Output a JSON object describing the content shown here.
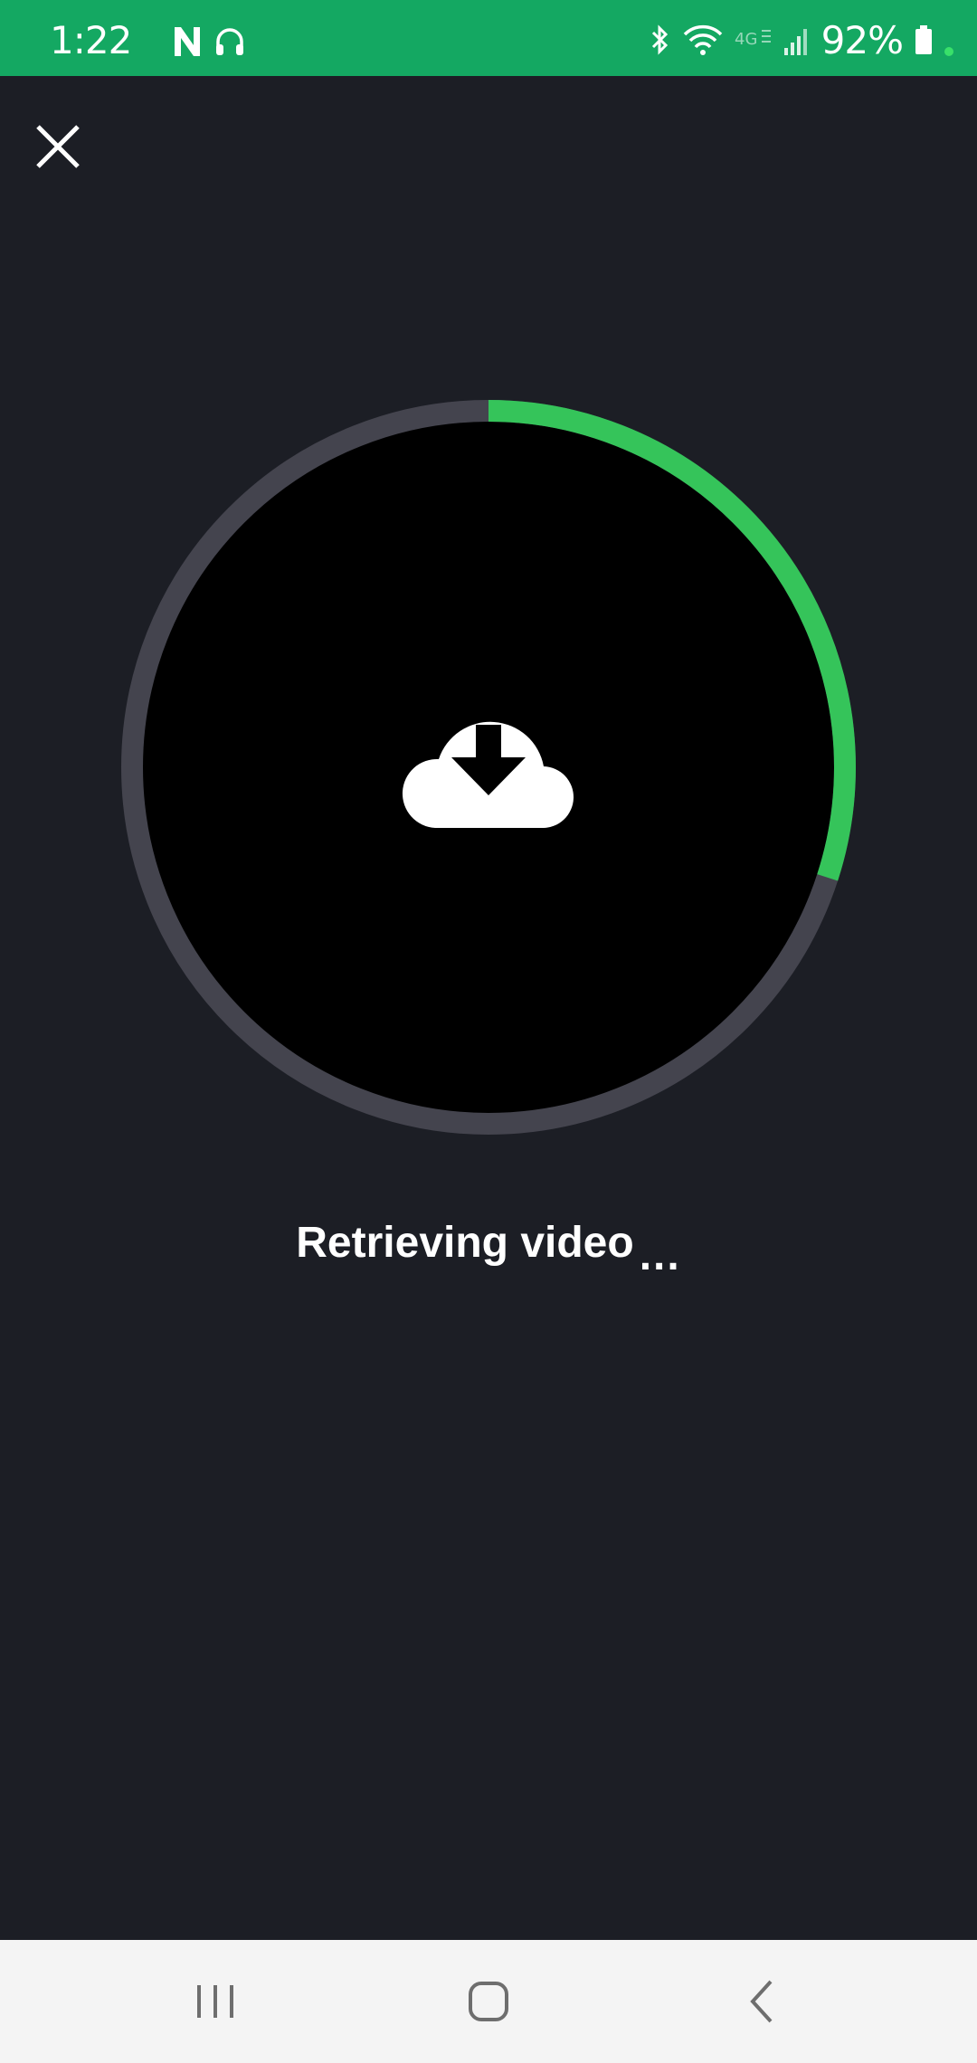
{
  "status_bar": {
    "time": "1:22",
    "battery_percent": "92%",
    "background_color": "#14a862",
    "icons": [
      "n-app-icon",
      "headset-icon",
      "bluetooth-icon",
      "wifi-icon",
      "4g-icon",
      "signal-icon",
      "battery-icon",
      "charging-dot"
    ]
  },
  "header": {
    "close_icon": "close-icon"
  },
  "progress": {
    "fraction": 0.3,
    "track_color": "#44444e",
    "fill_color": "#35c45a",
    "center_icon": "cloud-download-icon"
  },
  "message": {
    "text": "Retrieving video",
    "dots": "..."
  },
  "nav_bar": {
    "buttons": [
      "recents-icon",
      "home-icon",
      "back-icon"
    ]
  }
}
